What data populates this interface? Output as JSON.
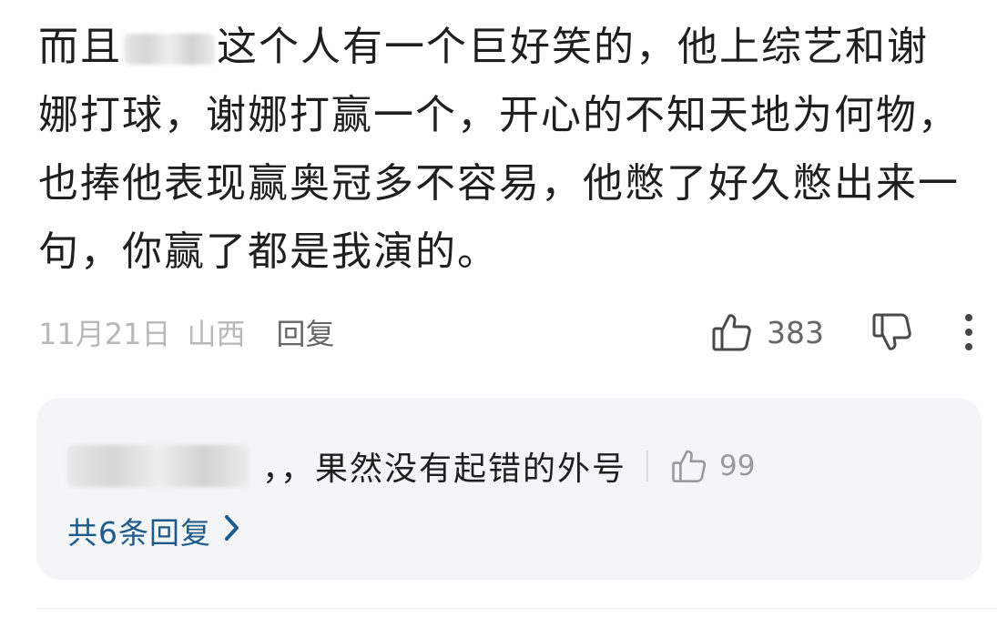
{
  "comment": {
    "text_before_name": "而且",
    "text_after_name": "这个人有一个巨好笑的，他上综艺和谢娜打球，谢娜打赢一个，开心的不知天地为何物，也捧他表现赢奥冠多不容易，他憋了好久憋出来一句，你赢了都是我演的。",
    "date": "11月21日",
    "location": "山西",
    "reply_label": "回复",
    "like_count": "383",
    "like_icon": "thumbs-up-icon",
    "dislike_icon": "thumbs-down-icon",
    "more_icon": "more-vertical-icon"
  },
  "replies": {
    "top_reply": {
      "text": "，，果然没有起错的外号",
      "like_count": "99"
    },
    "view_all_label": "共6条回复",
    "view_all_icon": "chevron-right-icon"
  },
  "colors": {
    "text_primary": "#1f1f1f",
    "text_meta": "#b8b8b8",
    "text_secondary": "#666666",
    "link": "#1e5a8a",
    "reply_background": "#f4f5f7"
  }
}
